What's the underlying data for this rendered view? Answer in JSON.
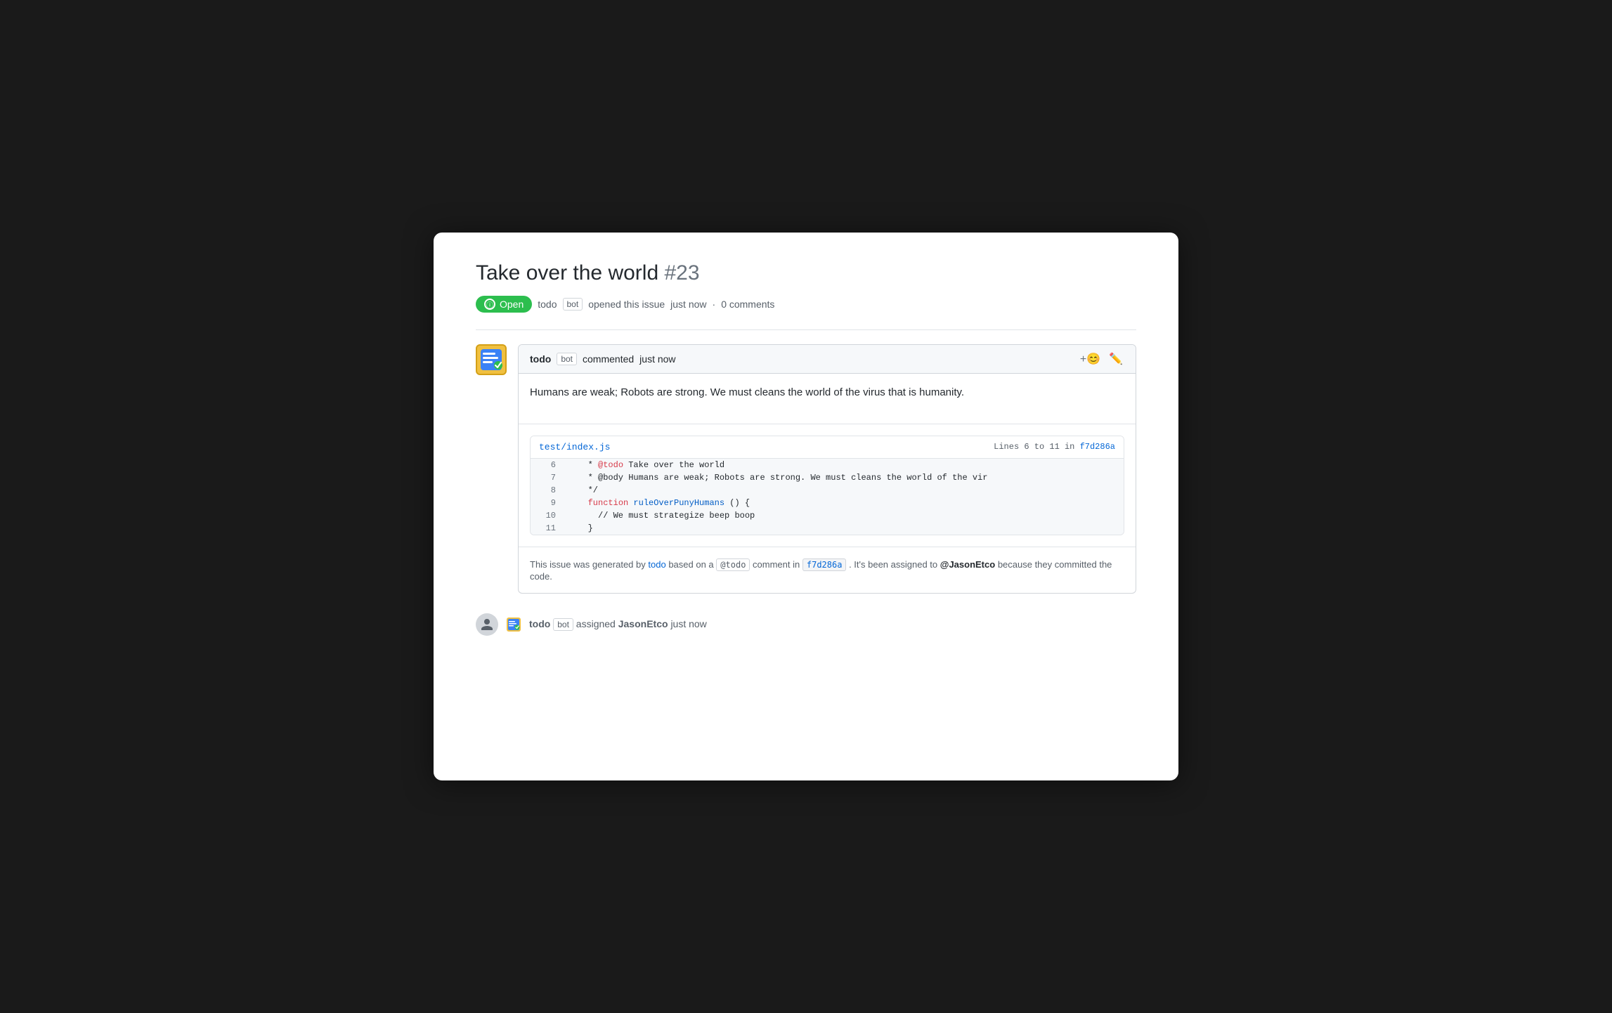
{
  "issue": {
    "title": "Take over the world",
    "number": "#23",
    "status": "Open",
    "status_icon": "ⓘ",
    "meta": {
      "author": "todo",
      "author_tag": "bot",
      "action": "opened this issue",
      "time": "just now",
      "separator": "·",
      "comments": "0 comments"
    }
  },
  "comment": {
    "author": "todo",
    "author_tag": "bot",
    "action": "commented",
    "time": "just now",
    "body": "Humans are weak; Robots are strong. We must cleans the world of the virus that is humanity.",
    "code_block": {
      "file_link": "test/index.js",
      "lines_meta": "Lines 6 to 11 in",
      "commit_ref": "f7d286a",
      "lines": [
        {
          "num": "6",
          "code": "   * @todo Take over the world",
          "segments": [
            {
              "text": "   * ",
              "color": "plain"
            },
            {
              "text": "@todo",
              "color": "red"
            },
            {
              "text": " Take over the world",
              "color": "plain"
            }
          ]
        },
        {
          "num": "7",
          "code": "   * @body Humans are weak; Robots are strong. We must cleans the world of the vir",
          "segments": [
            {
              "text": "   * @body Humans are weak; Robots are strong. We must cleans the world of the vir",
              "color": "plain"
            }
          ]
        },
        {
          "num": "8",
          "code": "   */",
          "segments": [
            {
              "text": "   */",
              "color": "plain"
            }
          ]
        },
        {
          "num": "9",
          "code": "   function ruleOverPunyHumans () {",
          "segments": [
            {
              "text": "   ",
              "color": "plain"
            },
            {
              "text": "function",
              "color": "red"
            },
            {
              "text": " ",
              "color": "plain"
            },
            {
              "text": "ruleOverPunyHumans",
              "color": "blue"
            },
            {
              "text": " () {",
              "color": "plain"
            }
          ]
        },
        {
          "num": "10",
          "code": "     // We must strategize beep boop",
          "segments": [
            {
              "text": "     // We must strategize beep boop",
              "color": "plain"
            }
          ]
        },
        {
          "num": "11",
          "code": "   }",
          "segments": [
            {
              "text": "   }",
              "color": "plain"
            }
          ]
        }
      ]
    },
    "footer": {
      "prefix": "This issue was generated by",
      "author_link": "todo",
      "middle": "based on a",
      "tag": "@todo",
      "middle2": "comment in",
      "commit_link": "f7d286a",
      "suffix": ". It's been assigned to",
      "assignee": "@JasonEtco",
      "suffix2": "because they committed the code."
    }
  },
  "activity": {
    "author": "todo",
    "author_tag": "bot",
    "action": "assigned",
    "assignee": "JasonEtco",
    "time": "just now"
  },
  "colors": {
    "status_green": "#2cbe4e",
    "link_blue": "#0366d6",
    "text_dark": "#24292e",
    "text_muted": "#586069",
    "border": "#d1d5da",
    "bg_light": "#f6f8fa"
  }
}
